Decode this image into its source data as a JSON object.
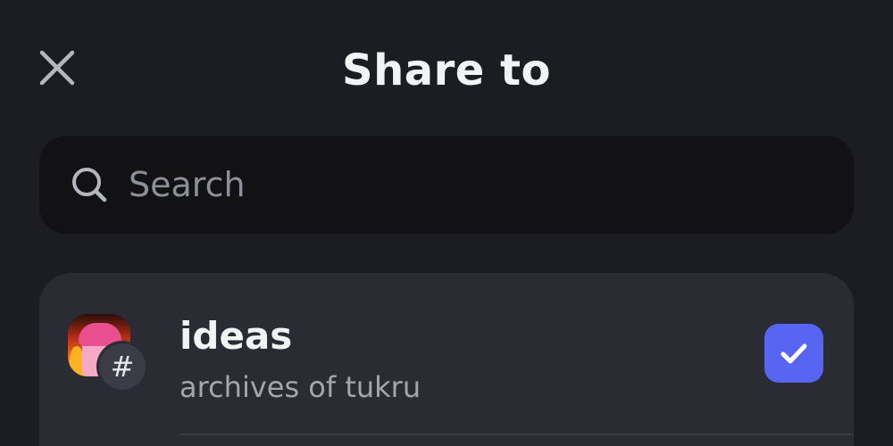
{
  "header": {
    "title": "Share to",
    "close_icon": "close-icon"
  },
  "search": {
    "placeholder": "Search",
    "value": "",
    "icon": "search-icon"
  },
  "channels": [
    {
      "name": "ideas",
      "server": "archives of tukru",
      "channel_icon": "hash-icon",
      "hash_glyph": "#",
      "avatar_icon": "server-avatar",
      "selected": true,
      "check_icon": "check-icon"
    }
  ],
  "colors": {
    "background": "#1c1d23",
    "search_background": "#121215",
    "card_background": "#2a2b33",
    "accent": "#5865f2",
    "text_primary": "#f2f3f5",
    "text_secondary": "#a4a6ae"
  }
}
